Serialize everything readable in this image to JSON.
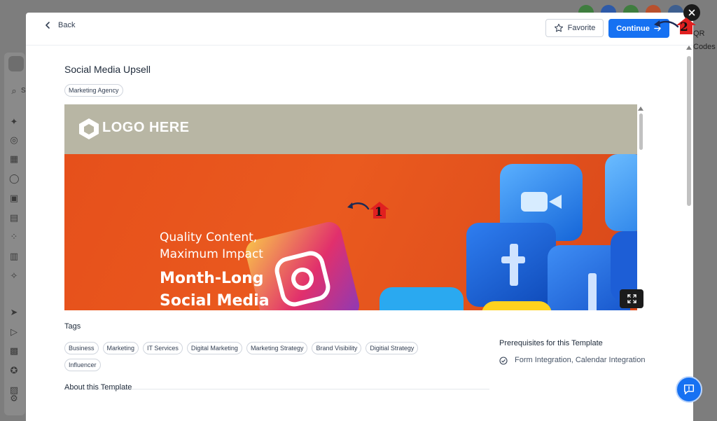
{
  "background_app": {
    "right_label_line1": "QR",
    "right_label_line2": "Codes",
    "sidebar_search_letter": "S"
  },
  "modal": {
    "back_label": "Back",
    "favorite_label": "Favorite",
    "continue_label": "Continue",
    "template_title": "Social Media Upsell",
    "category_chip": "Marketing Agency",
    "preview": {
      "logo_text": "LOGO HERE",
      "headline_line1": "Quality Content,",
      "headline_line2": "Maximum Impact",
      "headline_line3": "Month-Long",
      "headline_line4": "Social Media"
    },
    "tags_heading": "Tags",
    "tags": [
      "Business",
      "Marketing",
      "IT Services",
      "Digital Marketing",
      "Marketing Strategy",
      "Brand Visibility",
      "Digitial Strategy",
      "Influencer"
    ],
    "prereq_heading": "Prerequisites for this Template",
    "prereq_item": "Form Integration, Calendar Integration",
    "about_heading": "About this Template"
  },
  "annotations": {
    "step1": "1",
    "step2": "2"
  },
  "colors": {
    "primary": "#1671f2",
    "hero_orange": "#e6501b",
    "banner": "#b8b6a4",
    "step_marker": "#e02020"
  }
}
